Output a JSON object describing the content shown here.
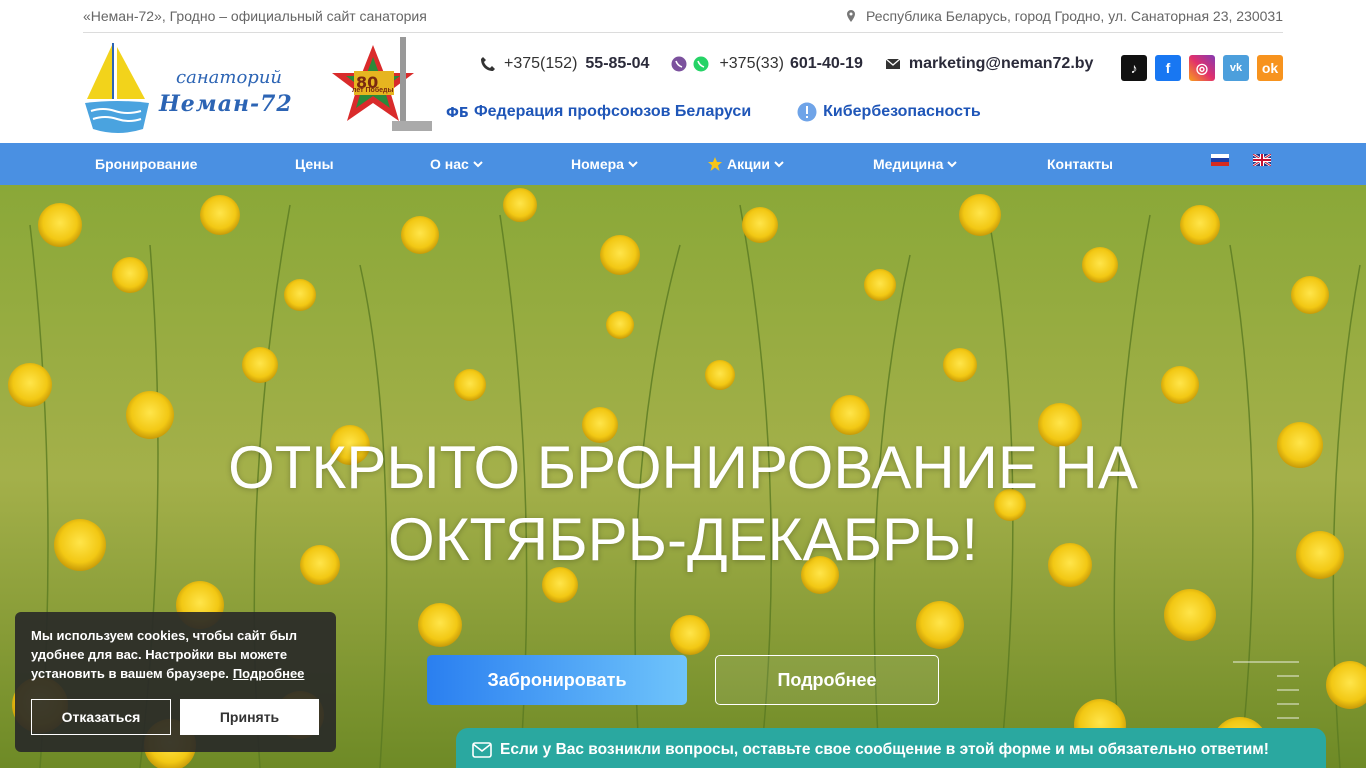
{
  "topbar": {
    "left_text": "«Неман-72», Гродно – официальный сайт санатория",
    "address": "Республика Беларусь, город Гродно, ул. Санаторная 23, 230031"
  },
  "logo": {
    "line1": "санаторий",
    "line2": "Неман-72"
  },
  "emblem": {
    "number": "80",
    "text": "лет Победы"
  },
  "contacts": {
    "phone1_prefix": "+375(152)",
    "phone1_number": "55-85-04",
    "phone2_prefix": "+375(33)",
    "phone2_number": "601-40-19",
    "email": "marketing@neman72.by"
  },
  "links": {
    "federation": "Федерация профсоюзов Беларуси",
    "cyber": "Кибербезопасность"
  },
  "nav": {
    "items": [
      "Бронирование",
      "Цены",
      "О нас",
      "Номера",
      "Акции",
      "Медицина",
      "Контакты"
    ]
  },
  "hero": {
    "title_line1": "ОТКРЫТО БРОНИРОВАНИЕ НА",
    "title_line2": "ОКТЯБРЬ-ДЕКАБРЬ!",
    "book_label": "Забронировать",
    "more_label": "Подробнее"
  },
  "cookie": {
    "text": "Мы используем cookies, чтобы сайт был удобнее для вас. Настройки вы можете установить в вашем браузере.",
    "more_link": "Подробнее",
    "decline": "Отказаться",
    "accept": "Принять"
  },
  "message_bar": {
    "text": "Если у Вас возникли вопросы, оставьте свое сообщение в этой форме и мы обязательно ответим!"
  },
  "colors": {
    "nav_bg": "#4a90e2",
    "link_blue": "#1f56b8",
    "message_bar": "#2aa8a0",
    "cookie_bg": "#282828"
  }
}
